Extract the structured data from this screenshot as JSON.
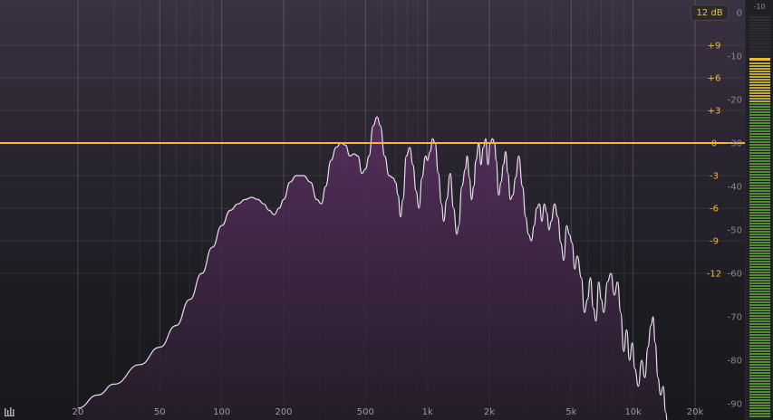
{
  "spectrum": {
    "range_label": "12 dB",
    "freq_labels": [
      {
        "label": "20",
        "hz": 20
      },
      {
        "label": "50",
        "hz": 50
      },
      {
        "label": "100",
        "hz": 100
      },
      {
        "label": "200",
        "hz": 200
      },
      {
        "label": "500",
        "hz": 500
      },
      {
        "label": "1k",
        "hz": 1000
      },
      {
        "label": "2k",
        "hz": 2000
      },
      {
        "label": "5k",
        "hz": 5000
      },
      {
        "label": "10k",
        "hz": 10000
      },
      {
        "label": "20k",
        "hz": 20000
      }
    ],
    "gain_labels": [
      {
        "label": "+9",
        "db": 9
      },
      {
        "label": "+6",
        "db": 6
      },
      {
        "label": "+3",
        "db": 3
      },
      {
        "label": "0",
        "db": 0
      },
      {
        "label": "-3",
        "db": -3
      },
      {
        "label": "-6",
        "db": -6
      },
      {
        "label": "-9",
        "db": -9
      },
      {
        "label": "-12",
        "db": -12
      }
    ],
    "level_labels": [
      {
        "label": "0",
        "db": 0
      },
      {
        "label": "-10",
        "db": -10
      },
      {
        "label": "-20",
        "db": -20
      },
      {
        "label": "-30",
        "db": -30
      },
      {
        "label": "-40",
        "db": -40
      },
      {
        "label": "-50",
        "db": -50
      },
      {
        "label": "-60",
        "db": -60
      },
      {
        "label": "-70",
        "db": -70
      },
      {
        "label": "-80",
        "db": -80
      },
      {
        "label": "-90",
        "db": -90
      }
    ],
    "eq_curve_gain_db": 0,
    "spectrum_points": [
      [
        20,
        -91
      ],
      [
        25,
        -88
      ],
      [
        30,
        -85.5
      ],
      [
        40,
        -81
      ],
      [
        50,
        -77
      ],
      [
        60,
        -72
      ],
      [
        70,
        -66
      ],
      [
        80,
        -60
      ],
      [
        90,
        -54
      ],
      [
        100,
        -49
      ],
      [
        110,
        -45.5
      ],
      [
        120,
        -44
      ],
      [
        130,
        -43
      ],
      [
        140,
        -42.5
      ],
      [
        150,
        -43
      ],
      [
        160,
        -44
      ],
      [
        170,
        -45.5
      ],
      [
        180,
        -46.5
      ],
      [
        190,
        -45
      ],
      [
        200,
        -43
      ],
      [
        215,
        -39
      ],
      [
        230,
        -37.5
      ],
      [
        250,
        -37.5
      ],
      [
        270,
        -39
      ],
      [
        290,
        -43
      ],
      [
        305,
        -44
      ],
      [
        320,
        -40
      ],
      [
        340,
        -34
      ],
      [
        360,
        -31
      ],
      [
        380,
        -30
      ],
      [
        400,
        -30.5
      ],
      [
        420,
        -33
      ],
      [
        440,
        -32.5
      ],
      [
        460,
        -33
      ],
      [
        480,
        -37
      ],
      [
        500,
        -36
      ],
      [
        520,
        -33
      ],
      [
        545,
        -26
      ],
      [
        570,
        -24
      ],
      [
        590,
        -26
      ],
      [
        620,
        -33
      ],
      [
        650,
        -37.5
      ],
      [
        680,
        -38
      ],
      [
        700,
        -39
      ],
      [
        720,
        -42
      ],
      [
        740,
        -47
      ],
      [
        760,
        -43
      ],
      [
        790,
        -33
      ],
      [
        820,
        -31
      ],
      [
        850,
        -35
      ],
      [
        880,
        -41
      ],
      [
        910,
        -45
      ],
      [
        940,
        -38
      ],
      [
        980,
        -33
      ],
      [
        1000,
        -34
      ],
      [
        1030,
        -32
      ],
      [
        1060,
        -29
      ],
      [
        1090,
        -30
      ],
      [
        1130,
        -37
      ],
      [
        1170,
        -44
      ],
      [
        1200,
        -48
      ],
      [
        1240,
        -43
      ],
      [
        1290,
        -37
      ],
      [
        1340,
        -45
      ],
      [
        1390,
        -51
      ],
      [
        1420,
        -49
      ],
      [
        1470,
        -40
      ],
      [
        1530,
        -36
      ],
      [
        1560,
        -33
      ],
      [
        1600,
        -38
      ],
      [
        1640,
        -43
      ],
      [
        1680,
        -40
      ],
      [
        1720,
        -34
      ],
      [
        1780,
        -30
      ],
      [
        1820,
        -35
      ],
      [
        1870,
        -31
      ],
      [
        1920,
        -29
      ],
      [
        1970,
        -35
      ],
      [
        2020,
        -30
      ],
      [
        2070,
        -29
      ],
      [
        2120,
        -30
      ],
      [
        2160,
        -34
      ],
      [
        2220,
        -42
      ],
      [
        2280,
        -39
      ],
      [
        2340,
        -35
      ],
      [
        2400,
        -32
      ],
      [
        2460,
        -37
      ],
      [
        2530,
        -43
      ],
      [
        2600,
        -42
      ],
      [
        2680,
        -38
      ],
      [
        2780,
        -33
      ],
      [
        2900,
        -40
      ],
      [
        3000,
        -47
      ],
      [
        3100,
        -51
      ],
      [
        3200,
        -52.5
      ],
      [
        3300,
        -49
      ],
      [
        3400,
        -45
      ],
      [
        3500,
        -44
      ],
      [
        3600,
        -48
      ],
      [
        3700,
        -44
      ],
      [
        3800,
        -46
      ],
      [
        3900,
        -50
      ],
      [
        4000,
        -48
      ],
      [
        4150,
        -44
      ],
      [
        4300,
        -47
      ],
      [
        4450,
        -53
      ],
      [
        4600,
        -57
      ],
      [
        4750,
        -49
      ],
      [
        4900,
        -51
      ],
      [
        5050,
        -53
      ],
      [
        5200,
        -59
      ],
      [
        5350,
        -56
      ],
      [
        5600,
        -61
      ],
      [
        5800,
        -69
      ],
      [
        6000,
        -66
      ],
      [
        6200,
        -61
      ],
      [
        6400,
        -68
      ],
      [
        6600,
        -71
      ],
      [
        6800,
        -62
      ],
      [
        7000,
        -66
      ],
      [
        7200,
        -69
      ],
      [
        7500,
        -62
      ],
      [
        7800,
        -60
      ],
      [
        8100,
        -65
      ],
      [
        8400,
        -62
      ],
      [
        8700,
        -69
      ],
      [
        9000,
        -78
      ],
      [
        9300,
        -73
      ],
      [
        9600,
        -80
      ],
      [
        9900,
        -76
      ],
      [
        10200,
        -82
      ],
      [
        10600,
        -86
      ],
      [
        11000,
        -80
      ],
      [
        11400,
        -84
      ],
      [
        11800,
        -77
      ],
      [
        12200,
        -72
      ],
      [
        12500,
        -70
      ],
      [
        12800,
        -76
      ],
      [
        13200,
        -84
      ],
      [
        13600,
        -88
      ],
      [
        14000,
        -86
      ],
      [
        14400,
        -92
      ],
      [
        14800,
        -98
      ]
    ]
  },
  "meter": {
    "scale_label": "-10",
    "level_db": -10.5,
    "peak_db": -10
  },
  "colors": {
    "accent": "#f2b83a",
    "curve": "#e6e0ea",
    "fill": "#4a2a4c",
    "meter_green": "#5f9a3c",
    "meter_yellow": "#d8c040"
  },
  "icons": {
    "corner": "meter-bars-icon"
  }
}
